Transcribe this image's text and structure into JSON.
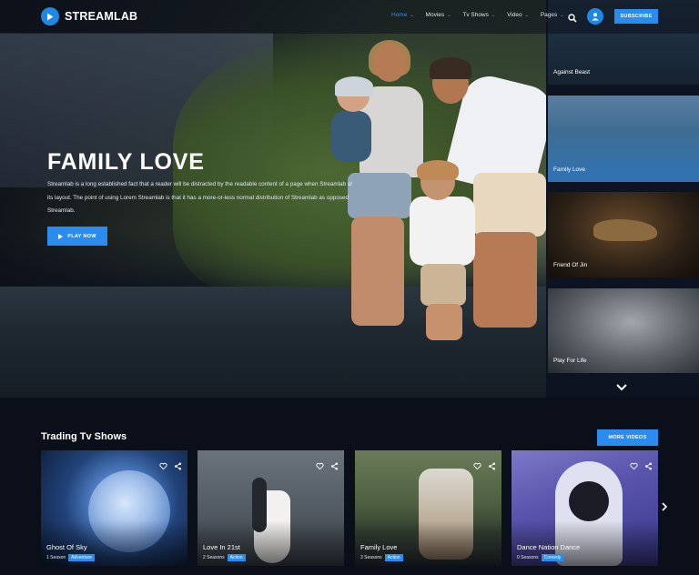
{
  "brand": {
    "name": "STREAMLAB",
    "accent": "#2a8cef"
  },
  "nav": {
    "items": [
      {
        "label": "Home",
        "active": true
      },
      {
        "label": "Movies",
        "active": false
      },
      {
        "label": "Tv Shows",
        "active": false
      },
      {
        "label": "Video",
        "active": false
      },
      {
        "label": "Pages",
        "active": false
      }
    ],
    "search_icon": "search-icon",
    "user_icon": "user-icon",
    "subscribe_label": "SUBSCRIBE"
  },
  "hero": {
    "title": "FAMILY LOVE",
    "description": "Streamlab is a long established fact that a reader will be distracted by the readable content of a page when Streamlab at its layout. The point of using Lorem Streamlab is that it has a more-or-less normal distribution of Streamlab as opposed Streamlab.",
    "play_label": "PLAY NOW"
  },
  "sidebar": {
    "items": [
      {
        "title": "Against Beast"
      },
      {
        "title": "Family Love"
      },
      {
        "title": "Friend Of Jin"
      },
      {
        "title": "Play For Life"
      }
    ],
    "down_icon": "chevron-down-icon"
  },
  "trending": {
    "title": "Trading Tv Shows",
    "more_label": "MORE VIDEOS",
    "cards": [
      {
        "title": "Ghost Of Sky",
        "seasons": "1 Season",
        "genre": "Adventure"
      },
      {
        "title": "Love In 21st",
        "seasons": "2 Seasons",
        "genre": "Action"
      },
      {
        "title": "Family Love",
        "seasons": "3 Seasons",
        "genre": "Action"
      },
      {
        "title": "Dance Nation Dance",
        "seasons": "0 Seasons",
        "genre": "Comedy"
      }
    ],
    "next_icon": "chevron-right-icon"
  }
}
